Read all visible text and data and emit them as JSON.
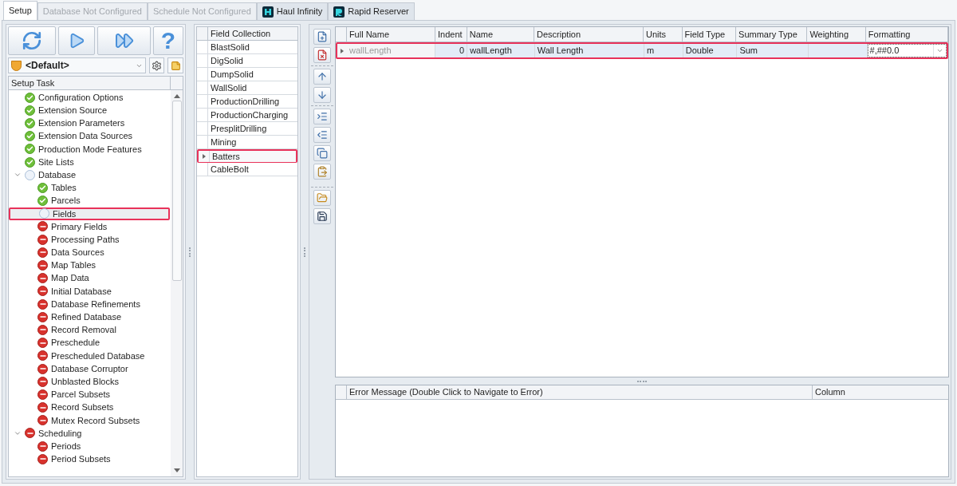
{
  "tabs": [
    {
      "label": "Setup",
      "selected": true,
      "disabled": false,
      "kind": "plain"
    },
    {
      "label": "Database Not Configured",
      "selected": false,
      "disabled": true,
      "kind": "plain"
    },
    {
      "label": "Schedule Not Configured",
      "selected": false,
      "disabled": true,
      "kind": "plain"
    },
    {
      "label": "Haul Infinity",
      "selected": false,
      "disabled": false,
      "kind": "logo_h"
    },
    {
      "label": "Rapid Reserver",
      "selected": false,
      "disabled": false,
      "kind": "logo_r"
    }
  ],
  "run_toolbar": [
    {
      "kind": "refresh"
    },
    {
      "kind": "run"
    },
    {
      "kind": "run_all"
    },
    {
      "kind": "help",
      "label": "?"
    }
  ],
  "profile": {
    "value": "<Default>"
  },
  "setup_tree": {
    "header": "Setup Task",
    "items": [
      {
        "label": "Configuration Options",
        "kind": "done",
        "selected": false
      },
      {
        "label": "Extension Source",
        "kind": "done",
        "selected": false
      },
      {
        "label": "Extension Parameters",
        "kind": "done",
        "selected": false
      },
      {
        "label": "Extension Data Sources",
        "kind": "done",
        "selected": false
      },
      {
        "label": "Production Mode Features",
        "kind": "done",
        "selected": false
      },
      {
        "label": "Site Lists",
        "kind": "done",
        "selected": false
      },
      {
        "label": "Database",
        "kind": "pending",
        "selected": false,
        "expanded": true,
        "children": [
          {
            "label": "Tables",
            "kind": "done",
            "selected": false
          },
          {
            "label": "Parcels",
            "kind": "done",
            "selected": false
          },
          {
            "label": "Fields",
            "kind": "pending",
            "selected": true
          },
          {
            "label": "Primary Fields",
            "kind": "error",
            "selected": false
          },
          {
            "label": "Processing Paths",
            "kind": "error",
            "selected": false
          },
          {
            "label": "Data Sources",
            "kind": "error",
            "selected": false
          },
          {
            "label": "Map Tables",
            "kind": "error",
            "selected": false
          },
          {
            "label": "Map Data",
            "kind": "error",
            "selected": false
          },
          {
            "label": "Initial Database",
            "kind": "error",
            "selected": false
          },
          {
            "label": "Database Refinements",
            "kind": "error",
            "selected": false
          },
          {
            "label": "Refined Database",
            "kind": "error",
            "selected": false
          },
          {
            "label": "Record Removal",
            "kind": "error",
            "selected": false
          },
          {
            "label": "Preschedule",
            "kind": "error",
            "selected": false
          },
          {
            "label": "Prescheduled Database",
            "kind": "error",
            "selected": false
          },
          {
            "label": "Database Corruptor",
            "kind": "error",
            "selected": false
          },
          {
            "label": "Unblasted Blocks",
            "kind": "error",
            "selected": false
          },
          {
            "label": "Parcel Subsets",
            "kind": "error",
            "selected": false
          },
          {
            "label": "Record Subsets",
            "kind": "error",
            "selected": false
          },
          {
            "label": "Mutex Record Subsets",
            "kind": "error",
            "selected": false
          }
        ]
      },
      {
        "label": "Scheduling",
        "kind": "error",
        "selected": false,
        "expanded": true,
        "children": [
          {
            "label": "Periods",
            "kind": "error",
            "selected": false
          },
          {
            "label": "Period Subsets",
            "kind": "error",
            "selected": false
          }
        ]
      }
    ]
  },
  "field_collection": {
    "header": "Field Collection",
    "rows": [
      {
        "label": "BlastSolid",
        "selected": false
      },
      {
        "label": "DigSolid",
        "selected": false
      },
      {
        "label": "DumpSolid",
        "selected": false
      },
      {
        "label": "WallSolid",
        "selected": false
      },
      {
        "label": "ProductionDrilling",
        "selected": false
      },
      {
        "label": "ProductionCharging",
        "selected": false
      },
      {
        "label": "PresplitDrilling",
        "selected": false
      },
      {
        "label": "Mining",
        "selected": false
      },
      {
        "label": "Batters",
        "selected": true
      },
      {
        "label": "CableBolt",
        "selected": false
      }
    ]
  },
  "side_toolbar": [
    {
      "buttons": [
        {
          "kind": "add"
        },
        {
          "kind": "delete"
        }
      ]
    },
    {
      "buttons": [
        {
          "kind": "up"
        },
        {
          "kind": "down"
        }
      ]
    },
    {
      "buttons": [
        {
          "kind": "indent"
        },
        {
          "kind": "outdent"
        },
        {
          "kind": "copy"
        },
        {
          "kind": "paste"
        }
      ]
    },
    {
      "buttons": [
        {
          "kind": "open"
        },
        {
          "kind": "save"
        }
      ]
    }
  ],
  "fields_table": {
    "columns": [
      {
        "label": "Full Name",
        "kind": "readonly"
      },
      {
        "label": "Indent",
        "kind": "number"
      },
      {
        "label": "Name",
        "kind": "text"
      },
      {
        "label": "Description",
        "kind": "text"
      },
      {
        "label": "Units",
        "kind": "text"
      },
      {
        "label": "Field Type",
        "kind": "text"
      },
      {
        "label": "Summary Type",
        "kind": "text"
      },
      {
        "label": "Weighting",
        "kind": "text"
      },
      {
        "label": "Formatting",
        "kind": "dropdown"
      }
    ],
    "rows": [
      {
        "selected": true,
        "cells": [
          "wallLength",
          "0",
          "wallLength",
          "Wall Length",
          "m",
          "Double",
          "Sum",
          null,
          "#,##0.0"
        ]
      }
    ]
  },
  "error_table": {
    "columns": [
      "Error Message (Double Click to Navigate to Error)",
      "Column"
    ]
  }
}
